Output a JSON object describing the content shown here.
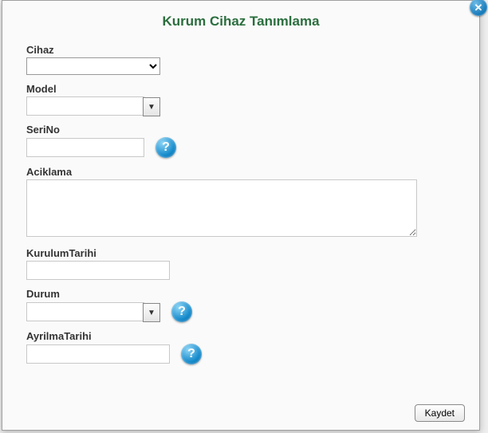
{
  "title": "Kurum Cihaz Tanımlama",
  "close_glyph": "✕",
  "help_glyph": "?",
  "dropdown_glyph": "▼",
  "fields": {
    "cihaz": {
      "label": "Cihaz",
      "value": ""
    },
    "model": {
      "label": "Model",
      "value": ""
    },
    "serino": {
      "label": "SeriNo",
      "value": ""
    },
    "aciklama": {
      "label": "Aciklama",
      "value": ""
    },
    "kurulum": {
      "label": "KurulumTarihi",
      "value": ""
    },
    "durum": {
      "label": "Durum",
      "value": ""
    },
    "ayrilma": {
      "label": "AyrilmaTarihi",
      "value": ""
    }
  },
  "buttons": {
    "save": "Kaydet"
  }
}
